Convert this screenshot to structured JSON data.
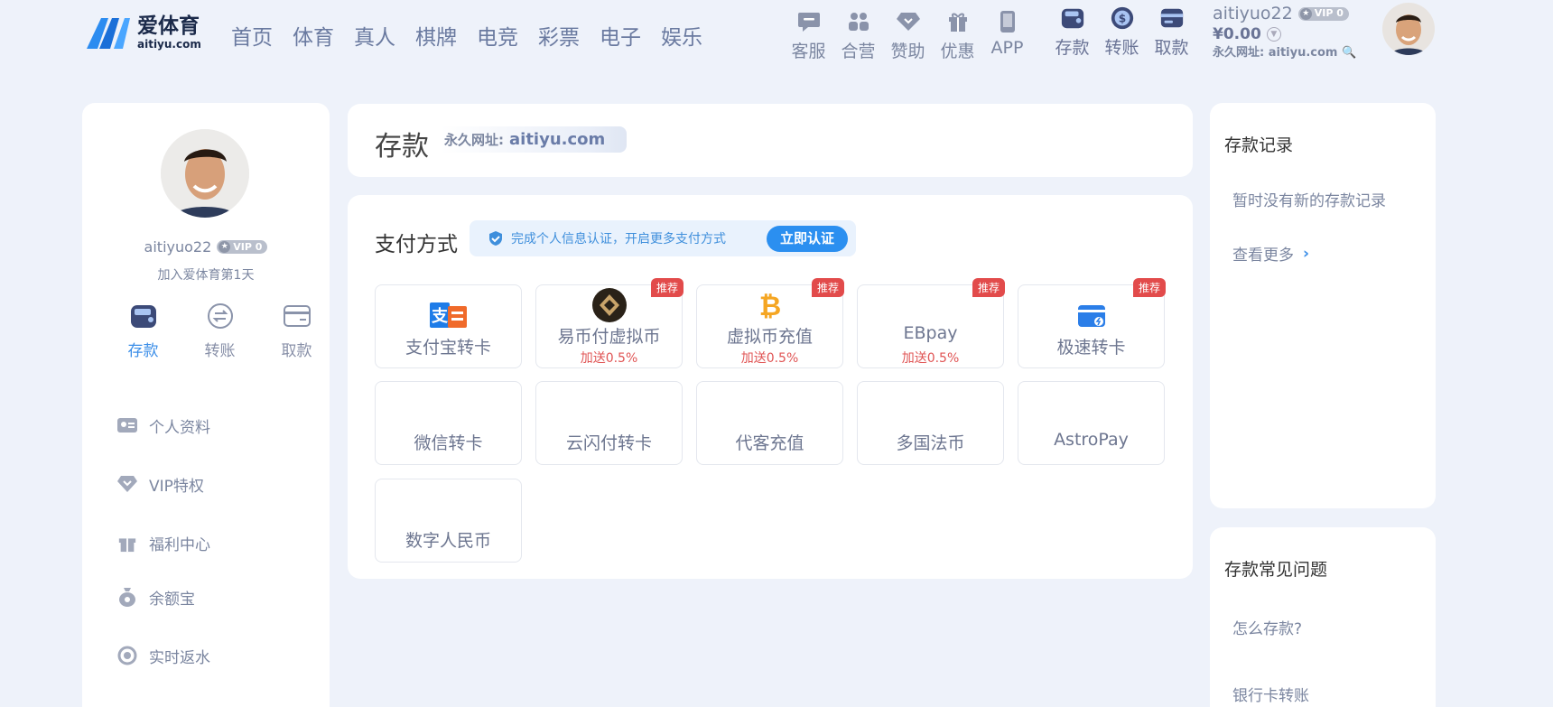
{
  "header": {
    "logo": {
      "cn": "爱体育",
      "en": "aitiyu.com"
    },
    "nav": [
      "首页",
      "体育",
      "真人",
      "棋牌",
      "电竞",
      "彩票",
      "电子",
      "娱乐"
    ],
    "tools": [
      {
        "label": "客服",
        "icon": "chat-icon"
      },
      {
        "label": "合营",
        "icon": "partners-icon"
      },
      {
        "label": "赞助",
        "icon": "sponsor-diamond-icon"
      },
      {
        "label": "优惠",
        "icon": "gift-icon"
      },
      {
        "label": "APP",
        "icon": "phone-icon"
      }
    ],
    "wallet": [
      {
        "label": "存款",
        "icon": "wallet-icon"
      },
      {
        "label": "转账",
        "icon": "transfer-coin-icon"
      },
      {
        "label": "取款",
        "icon": "withdraw-card-icon"
      }
    ],
    "user": {
      "name": "aitiyuo22",
      "vip": "VIP 0",
      "balance": "¥0.00",
      "url_label": "永久网址: aitiyu.com"
    }
  },
  "sidebar": {
    "username": "aitiyuo22",
    "vip": "VIP 0",
    "join_text": "加入爱体育第1天",
    "actions": [
      {
        "label": "存款",
        "icon": "wallet-icon",
        "active": true
      },
      {
        "label": "转账",
        "icon": "transfer-icon",
        "active": false
      },
      {
        "label": "取款",
        "icon": "card-icon",
        "active": false
      }
    ],
    "menu": [
      {
        "label": "个人资料",
        "icon": "id-card-icon"
      },
      {
        "label": "VIP特权",
        "icon": "vip-diamond-icon"
      },
      {
        "label": "福利中心",
        "icon": "gift-icon"
      },
      {
        "label": "余额宝",
        "icon": "money-bag-icon"
      },
      {
        "label": "实时返水",
        "icon": "rebate-icon"
      }
    ]
  },
  "deposit": {
    "title": "存款",
    "url_key": "永久网址:",
    "url_value": "aitiyu.com"
  },
  "payment": {
    "title": "支付方式",
    "verify_text": "完成个人信息认证，开启更多支付方式",
    "verify_button": "立即认证",
    "methods": [
      {
        "name": "支付宝转卡",
        "badge": "",
        "sub": "",
        "icon": "alipay-icon"
      },
      {
        "name": "易币付虚拟币",
        "badge": "推荐",
        "sub": "加送0.5%",
        "icon": "ebpay-coin-icon"
      },
      {
        "name": "虚拟币充值",
        "badge": "推荐",
        "sub": "加送0.5%",
        "icon": "bitcoin-icon"
      },
      {
        "name": "EBpay",
        "badge": "推荐",
        "sub": "加送0.5%",
        "icon": ""
      },
      {
        "name": "极速转卡",
        "badge": "推荐",
        "sub": "",
        "icon": "fast-card-icon"
      },
      {
        "name": "微信转卡",
        "badge": "",
        "sub": "",
        "icon": ""
      },
      {
        "name": "云闪付转卡",
        "badge": "",
        "sub": "",
        "icon": ""
      },
      {
        "name": "代客充值",
        "badge": "",
        "sub": "",
        "icon": ""
      },
      {
        "name": "多国法币",
        "badge": "",
        "sub": "",
        "icon": ""
      },
      {
        "name": "AstroPay",
        "badge": "",
        "sub": "",
        "icon": ""
      },
      {
        "name": "数字人民币",
        "badge": "",
        "sub": "",
        "icon": ""
      }
    ]
  },
  "records": {
    "title": "存款记录",
    "empty": "暂时没有新的存款记录",
    "more": "查看更多"
  },
  "faq": {
    "title": "存款常见问题",
    "items": [
      "怎么存款?",
      "银行卡转账"
    ]
  },
  "colors": {
    "accent": "#2b8ff0",
    "badge": "#e24b4b",
    "bonus": "#e05555",
    "background": "#eef2fa"
  }
}
